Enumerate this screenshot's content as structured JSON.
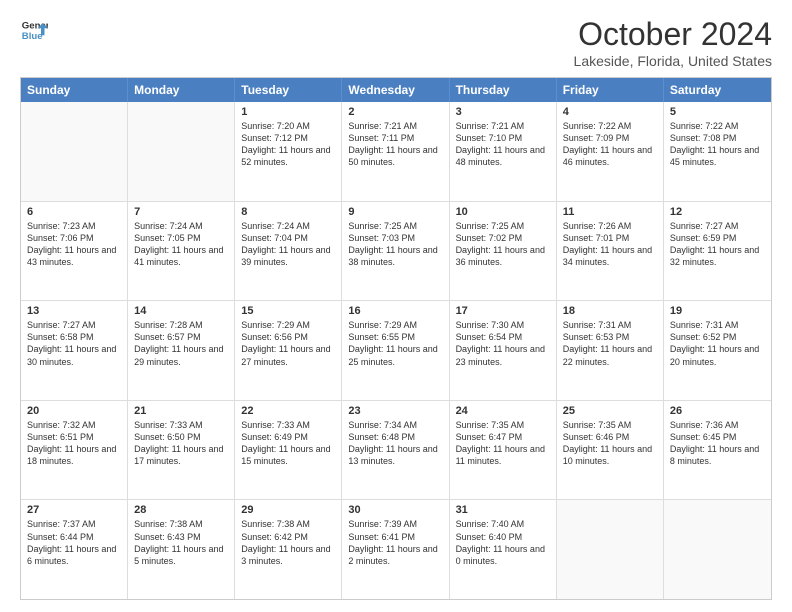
{
  "logo": {
    "line1": "General",
    "line2": "Blue"
  },
  "title": "October 2024",
  "subtitle": "Lakeside, Florida, United States",
  "days_of_week": [
    "Sunday",
    "Monday",
    "Tuesday",
    "Wednesday",
    "Thursday",
    "Friday",
    "Saturday"
  ],
  "weeks": [
    [
      {
        "day": "",
        "empty": true
      },
      {
        "day": "",
        "empty": true
      },
      {
        "day": "1",
        "sunrise": "7:20 AM",
        "sunset": "7:12 PM",
        "daylight": "11 hours and 52 minutes."
      },
      {
        "day": "2",
        "sunrise": "7:21 AM",
        "sunset": "7:11 PM",
        "daylight": "11 hours and 50 minutes."
      },
      {
        "day": "3",
        "sunrise": "7:21 AM",
        "sunset": "7:10 PM",
        "daylight": "11 hours and 48 minutes."
      },
      {
        "day": "4",
        "sunrise": "7:22 AM",
        "sunset": "7:09 PM",
        "daylight": "11 hours and 46 minutes."
      },
      {
        "day": "5",
        "sunrise": "7:22 AM",
        "sunset": "7:08 PM",
        "daylight": "11 hours and 45 minutes."
      }
    ],
    [
      {
        "day": "6",
        "sunrise": "7:23 AM",
        "sunset": "7:06 PM",
        "daylight": "11 hours and 43 minutes."
      },
      {
        "day": "7",
        "sunrise": "7:24 AM",
        "sunset": "7:05 PM",
        "daylight": "11 hours and 41 minutes."
      },
      {
        "day": "8",
        "sunrise": "7:24 AM",
        "sunset": "7:04 PM",
        "daylight": "11 hours and 39 minutes."
      },
      {
        "day": "9",
        "sunrise": "7:25 AM",
        "sunset": "7:03 PM",
        "daylight": "11 hours and 38 minutes."
      },
      {
        "day": "10",
        "sunrise": "7:25 AM",
        "sunset": "7:02 PM",
        "daylight": "11 hours and 36 minutes."
      },
      {
        "day": "11",
        "sunrise": "7:26 AM",
        "sunset": "7:01 PM",
        "daylight": "11 hours and 34 minutes."
      },
      {
        "day": "12",
        "sunrise": "7:27 AM",
        "sunset": "6:59 PM",
        "daylight": "11 hours and 32 minutes."
      }
    ],
    [
      {
        "day": "13",
        "sunrise": "7:27 AM",
        "sunset": "6:58 PM",
        "daylight": "11 hours and 30 minutes."
      },
      {
        "day": "14",
        "sunrise": "7:28 AM",
        "sunset": "6:57 PM",
        "daylight": "11 hours and 29 minutes."
      },
      {
        "day": "15",
        "sunrise": "7:29 AM",
        "sunset": "6:56 PM",
        "daylight": "11 hours and 27 minutes."
      },
      {
        "day": "16",
        "sunrise": "7:29 AM",
        "sunset": "6:55 PM",
        "daylight": "11 hours and 25 minutes."
      },
      {
        "day": "17",
        "sunrise": "7:30 AM",
        "sunset": "6:54 PM",
        "daylight": "11 hours and 23 minutes."
      },
      {
        "day": "18",
        "sunrise": "7:31 AM",
        "sunset": "6:53 PM",
        "daylight": "11 hours and 22 minutes."
      },
      {
        "day": "19",
        "sunrise": "7:31 AM",
        "sunset": "6:52 PM",
        "daylight": "11 hours and 20 minutes."
      }
    ],
    [
      {
        "day": "20",
        "sunrise": "7:32 AM",
        "sunset": "6:51 PM",
        "daylight": "11 hours and 18 minutes."
      },
      {
        "day": "21",
        "sunrise": "7:33 AM",
        "sunset": "6:50 PM",
        "daylight": "11 hours and 17 minutes."
      },
      {
        "day": "22",
        "sunrise": "7:33 AM",
        "sunset": "6:49 PM",
        "daylight": "11 hours and 15 minutes."
      },
      {
        "day": "23",
        "sunrise": "7:34 AM",
        "sunset": "6:48 PM",
        "daylight": "11 hours and 13 minutes."
      },
      {
        "day": "24",
        "sunrise": "7:35 AM",
        "sunset": "6:47 PM",
        "daylight": "11 hours and 11 minutes."
      },
      {
        "day": "25",
        "sunrise": "7:35 AM",
        "sunset": "6:46 PM",
        "daylight": "11 hours and 10 minutes."
      },
      {
        "day": "26",
        "sunrise": "7:36 AM",
        "sunset": "6:45 PM",
        "daylight": "11 hours and 8 minutes."
      }
    ],
    [
      {
        "day": "27",
        "sunrise": "7:37 AM",
        "sunset": "6:44 PM",
        "daylight": "11 hours and 6 minutes."
      },
      {
        "day": "28",
        "sunrise": "7:38 AM",
        "sunset": "6:43 PM",
        "daylight": "11 hours and 5 minutes."
      },
      {
        "day": "29",
        "sunrise": "7:38 AM",
        "sunset": "6:42 PM",
        "daylight": "11 hours and 3 minutes."
      },
      {
        "day": "30",
        "sunrise": "7:39 AM",
        "sunset": "6:41 PM",
        "daylight": "11 hours and 2 minutes."
      },
      {
        "day": "31",
        "sunrise": "7:40 AM",
        "sunset": "6:40 PM",
        "daylight": "11 hours and 0 minutes."
      },
      {
        "day": "",
        "empty": true
      },
      {
        "day": "",
        "empty": true
      }
    ]
  ],
  "labels": {
    "sunrise_prefix": "Sunrise: ",
    "sunset_prefix": "Sunset: ",
    "daylight_prefix": "Daylight: "
  }
}
